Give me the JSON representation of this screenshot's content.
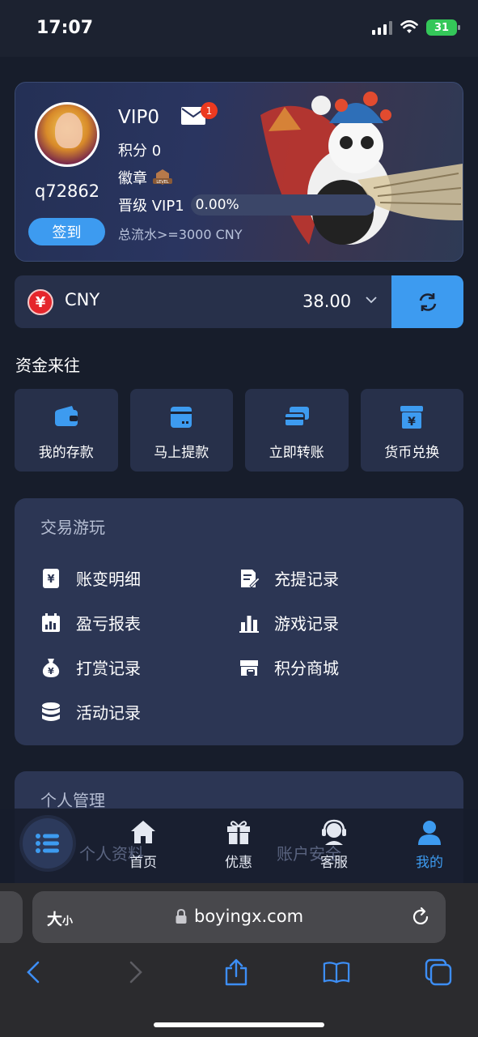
{
  "status_bar": {
    "time": "17:07",
    "battery": "31"
  },
  "profile": {
    "username": "q72862",
    "checkin_label": "签到",
    "vip_level": "VIP0",
    "mail_count": "1",
    "points": "积分 0",
    "badge_label": "徽章",
    "badge_level_text": "LEVEL",
    "upgrade_label": "晋级 VIP1",
    "progress_text": "0.00%",
    "progress_fraction": 0,
    "turnover_text": "总流水>=3000 CNY"
  },
  "wallet": {
    "currency_symbol": "¥",
    "currency": "CNY",
    "balance": "38.00"
  },
  "funds": {
    "title": "资金来往",
    "items": [
      {
        "label": "我的存款",
        "icon": "wallet-icon"
      },
      {
        "label": "马上提款",
        "icon": "withdraw-card-icon"
      },
      {
        "label": "立即转账",
        "icon": "transfer-cards-icon"
      },
      {
        "label": "货币兑换",
        "icon": "currency-exchange-icon"
      }
    ]
  },
  "trade": {
    "title": "交易游玩",
    "items": [
      {
        "label": "账变明细",
        "icon": "ledger-icon"
      },
      {
        "label": "充提记录",
        "icon": "edit-document-icon"
      },
      {
        "label": "盈亏报表",
        "icon": "calendar-report-icon"
      },
      {
        "label": "游戏记录",
        "icon": "bar-chart-icon"
      },
      {
        "label": "打赏记录",
        "icon": "money-bag-icon"
      },
      {
        "label": "积分商城",
        "icon": "store-icon"
      },
      {
        "label": "活动记录",
        "icon": "database-icon"
      }
    ]
  },
  "personal": {
    "title": "个人管理",
    "items": [
      {
        "label": "个人资料"
      },
      {
        "label": "账户安全"
      }
    ]
  },
  "bottom_nav": {
    "items": [
      {
        "label": "首页",
        "icon": "home-icon"
      },
      {
        "label": "优惠",
        "icon": "gift-icon"
      },
      {
        "label": "客服",
        "icon": "headset-icon"
      },
      {
        "label": "我的",
        "icon": "user-icon"
      }
    ],
    "active": "我的"
  },
  "browser": {
    "text_size_label": "大",
    "text_size_small": "小",
    "url": "boyingx.com"
  },
  "colors": {
    "accent": "#3d9bf0",
    "background": "#171d2b",
    "card": "#2c3654",
    "badge": "#ec3a20"
  }
}
